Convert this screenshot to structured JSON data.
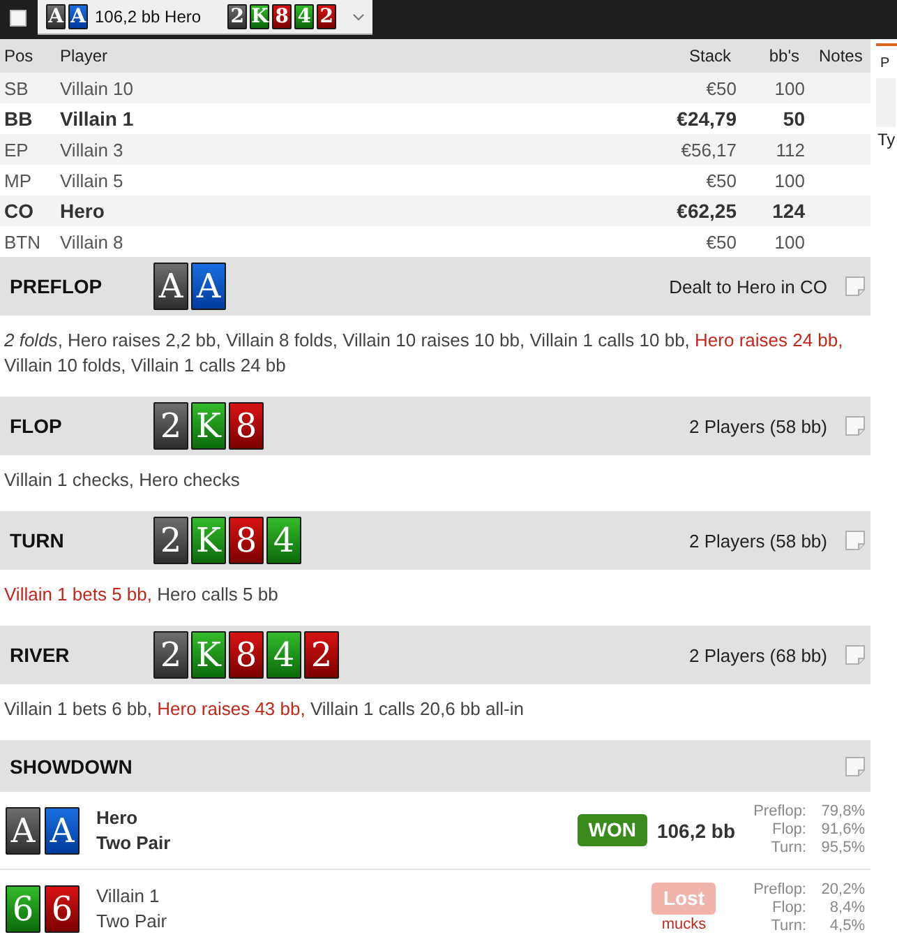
{
  "top_bar": {
    "checked": false,
    "hand_selector": {
      "hole_cards": [
        {
          "rank": "A",
          "kind": "spades"
        },
        {
          "rank": "A",
          "kind": "diamonds"
        }
      ],
      "label": "106,2 bb Hero",
      "board": [
        {
          "rank": "2",
          "kind": "spades"
        },
        {
          "rank": "K",
          "kind": "clubs"
        },
        {
          "rank": "8",
          "kind": "hearts"
        },
        {
          "rank": "4",
          "kind": "clubs"
        },
        {
          "rank": "2",
          "kind": "hearts"
        }
      ]
    }
  },
  "players_table": {
    "columns": [
      "Pos",
      "Player",
      "Stack",
      "bb's",
      "Notes"
    ],
    "rows": [
      {
        "pos": "SB",
        "player": "Villain 10",
        "stack": "€50",
        "bbs": "100",
        "highlighted": false
      },
      {
        "pos": "BB",
        "player": "Villain 1",
        "stack": "€24,79",
        "bbs": "50",
        "highlighted": true
      },
      {
        "pos": "EP",
        "player": "Villain 3",
        "stack": "€56,17",
        "bbs": "112",
        "highlighted": false
      },
      {
        "pos": "MP",
        "player": "Villain 5",
        "stack": "€50",
        "bbs": "100",
        "highlighted": false
      },
      {
        "pos": "CO",
        "player": "Hero",
        "stack": "€62,25",
        "bbs": "124",
        "highlighted": true
      },
      {
        "pos": "BTN",
        "player": "Villain 8",
        "stack": "€50",
        "bbs": "100",
        "highlighted": false
      }
    ]
  },
  "streets": [
    {
      "name": "PREFLOP",
      "cards": [
        {
          "rank": "A",
          "kind": "spades"
        },
        {
          "rank": "A",
          "kind": "diamonds"
        }
      ],
      "info": "Dealt to Hero in CO",
      "actions": [
        {
          "text": "*2 folds*, Hero raises 2,2 bb, Villain 8 folds, Villain 10 raises 10 bb, Villain 1 calls 10 bb, ",
          "highlight": false
        },
        {
          "text": "Hero raises 24 bb,",
          "highlight": true
        },
        {
          "text": " Villain 10 folds, Villain 1 calls 24 bb",
          "highlight": false
        }
      ]
    },
    {
      "name": "FLOP",
      "cards": [
        {
          "rank": "2",
          "kind": "spades"
        },
        {
          "rank": "K",
          "kind": "clubs"
        },
        {
          "rank": "8",
          "kind": "hearts"
        }
      ],
      "info": "2 Players (58 bb)",
      "actions": [
        {
          "text": "Villain 1 checks, Hero checks",
          "highlight": false
        }
      ]
    },
    {
      "name": "TURN",
      "cards": [
        {
          "rank": "2",
          "kind": "spades"
        },
        {
          "rank": "K",
          "kind": "clubs"
        },
        {
          "rank": "8",
          "kind": "hearts"
        },
        {
          "rank": "4",
          "kind": "clubs"
        }
      ],
      "info": "2 Players (58 bb)",
      "actions": [
        {
          "text": "Villain 1 bets 5 bb,",
          "highlight": true
        },
        {
          "text": " Hero calls 5 bb",
          "highlight": false
        }
      ]
    },
    {
      "name": "RIVER",
      "cards": [
        {
          "rank": "2",
          "kind": "spades"
        },
        {
          "rank": "K",
          "kind": "clubs"
        },
        {
          "rank": "8",
          "kind": "hearts"
        },
        {
          "rank": "4",
          "kind": "clubs"
        },
        {
          "rank": "2",
          "kind": "hearts"
        }
      ],
      "info": "2 Players (68 bb)",
      "actions": [
        {
          "text": "Villain 1 bets 6 bb, ",
          "highlight": false
        },
        {
          "text": "Hero raises 43 bb,",
          "highlight": true
        },
        {
          "text": " Villain 1 calls 20,6 bb all-in",
          "highlight": false
        }
      ]
    }
  ],
  "showdown": {
    "title": "SHOWDOWN",
    "players": [
      {
        "cards": [
          {
            "rank": "A",
            "kind": "spades"
          },
          {
            "rank": "A",
            "kind": "diamonds"
          }
        ],
        "name": "Hero",
        "hand": "Two Pair",
        "won": true,
        "result_label": "WON",
        "amount": "106,2 bb",
        "equity": [
          {
            "label": "Preflop:",
            "value": "79,8%"
          },
          {
            "label": "Flop:",
            "value": "91,6%"
          },
          {
            "label": "Turn:",
            "value": "95,5%"
          }
        ]
      },
      {
        "cards": [
          {
            "rank": "6",
            "kind": "clubs"
          },
          {
            "rank": "6",
            "kind": "hearts"
          }
        ],
        "name": "Villain 1",
        "hand": "Two Pair",
        "won": false,
        "result_label": "Lost",
        "note": "mucks",
        "equity": [
          {
            "label": "Preflop:",
            "value": "20,2%"
          },
          {
            "label": "Flop:",
            "value": "8,4%"
          },
          {
            "label": "Turn:",
            "value": "4,5%"
          }
        ]
      }
    ]
  },
  "side_panel": {
    "tab": "P",
    "text": "Ty"
  }
}
